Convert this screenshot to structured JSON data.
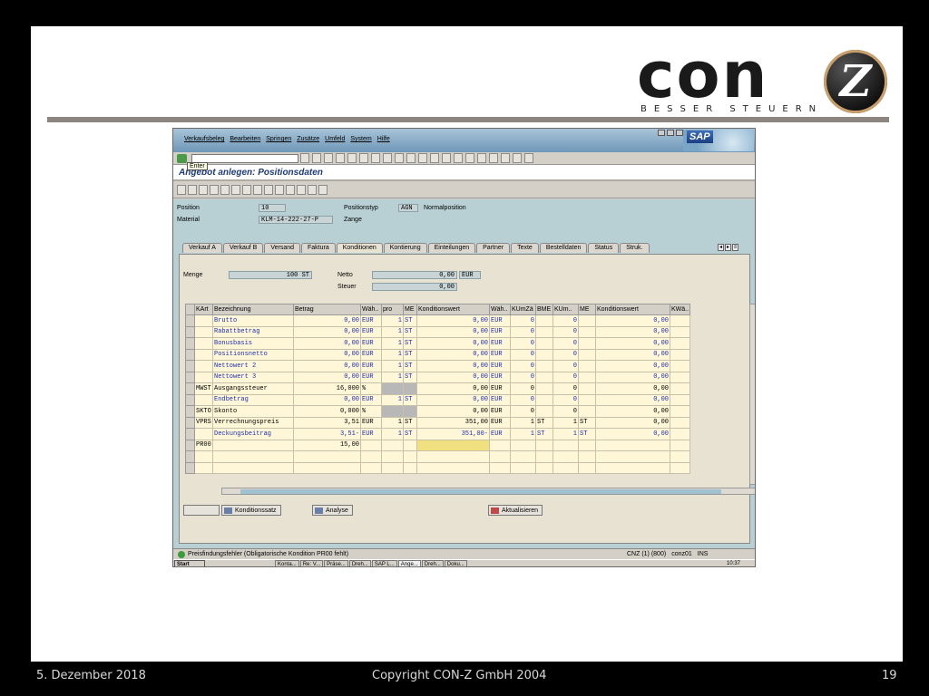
{
  "footer": {
    "date": "5. Dezember 2018",
    "copyright": "Copyright CON-Z GmbH 2004",
    "page": "19"
  },
  "logo": {
    "word": "con",
    "letter": "Z",
    "tagline": "BESSER STEUERN"
  },
  "sap": {
    "menu": [
      "Verkaufsbeleg",
      "Bearbeiten",
      "Springen",
      "Zusätze",
      "Umfeld",
      "System",
      "Hilfe"
    ],
    "logo": "SAP",
    "tooltip": "Enter",
    "title": "Angebot anlegen: Positionsdaten",
    "header": {
      "position_label": "Position",
      "position_value": "10",
      "material_label": "Material",
      "material_value": "KLM-14-222-27-P",
      "postyp_label": "Positionstyp",
      "postyp_value": "AGN",
      "postyp_text": "Normalposition",
      "material_text": "Zange"
    },
    "tabs": [
      "Verkauf A",
      "Verkauf B",
      "Versand",
      "Faktura",
      "Konditionen",
      "Kontierung",
      "Einteilungen",
      "Partner",
      "Texte",
      "Bestelldaten",
      "Status",
      "Struk."
    ],
    "active_tab": "Konditionen",
    "menge_label": "Menge",
    "menge_value": "100 ST",
    "netto_label": "Netto",
    "netto_value": "0,00",
    "netto_cur": "EUR",
    "steuer_label": "Steuer",
    "steuer_value": "0,00",
    "columns": [
      "KArt",
      "Bezeichnung",
      "Betrag",
      "Wäh..",
      "pro",
      "ME",
      "Konditionswert",
      "Wäh..",
      "KUmZä",
      "BME",
      "KUm..",
      "ME",
      "Konditionswert",
      "KWä.."
    ],
    "rows": [
      {
        "kart": "",
        "bez": "Brutto",
        "betrag": "0,00",
        "waeh": "EUR",
        "pro": "1",
        "me": "ST",
        "kwert": "0,00",
        "waeh2": "EUR",
        "kumza": "0",
        "bme": "",
        "kum": "0",
        "me2": "",
        "kwert2": "0,00",
        "blue": true
      },
      {
        "kart": "",
        "bez": "Rabattbetrag",
        "betrag": "0,00",
        "waeh": "EUR",
        "pro": "1",
        "me": "ST",
        "kwert": "0,00",
        "waeh2": "EUR",
        "kumza": "0",
        "bme": "",
        "kum": "0",
        "me2": "",
        "kwert2": "0,00",
        "blue": true
      },
      {
        "kart": "",
        "bez": "Bonusbasis",
        "betrag": "0,00",
        "waeh": "EUR",
        "pro": "1",
        "me": "ST",
        "kwert": "0,00",
        "waeh2": "EUR",
        "kumza": "0",
        "bme": "",
        "kum": "0",
        "me2": "",
        "kwert2": "0,00",
        "blue": true
      },
      {
        "kart": "",
        "bez": "Positionsnetto",
        "betrag": "0,00",
        "waeh": "EUR",
        "pro": "1",
        "me": "ST",
        "kwert": "0,00",
        "waeh2": "EUR",
        "kumza": "0",
        "bme": "",
        "kum": "0",
        "me2": "",
        "kwert2": "0,00",
        "blue": true
      },
      {
        "kart": "",
        "bez": "Nettowert 2",
        "betrag": "0,00",
        "waeh": "EUR",
        "pro": "1",
        "me": "ST",
        "kwert": "0,00",
        "waeh2": "EUR",
        "kumza": "0",
        "bme": "",
        "kum": "0",
        "me2": "",
        "kwert2": "0,00",
        "blue": true
      },
      {
        "kart": "",
        "bez": "Nettowert 3",
        "betrag": "0,00",
        "waeh": "EUR",
        "pro": "1",
        "me": "ST",
        "kwert": "0,00",
        "waeh2": "EUR",
        "kumza": "0",
        "bme": "",
        "kum": "0",
        "me2": "",
        "kwert2": "0,00",
        "blue": true
      },
      {
        "kart": "MWST",
        "bez": "Ausgangssteuer",
        "betrag": "16,000",
        "waeh": "%",
        "pro": "",
        "me": "",
        "kwert": "0,00",
        "waeh2": "EUR",
        "kumza": "0",
        "bme": "",
        "kum": "0",
        "me2": "",
        "kwert2": "0,00",
        "blue": false,
        "grey": true
      },
      {
        "kart": "",
        "bez": "Endbetrag",
        "betrag": "0,00",
        "waeh": "EUR",
        "pro": "1",
        "me": "ST",
        "kwert": "0,00",
        "waeh2": "EUR",
        "kumza": "0",
        "bme": "",
        "kum": "0",
        "me2": "",
        "kwert2": "0,00",
        "blue": true
      },
      {
        "kart": "SKTO",
        "bez": "Skonto",
        "betrag": "0,000",
        "waeh": "%",
        "pro": "",
        "me": "",
        "kwert": "0,00",
        "waeh2": "EUR",
        "kumza": "0",
        "bme": "",
        "kum": "0",
        "me2": "",
        "kwert2": "0,00",
        "blue": false,
        "grey": true
      },
      {
        "kart": "VPRS",
        "bez": "Verrechnungspreis",
        "betrag": "3,51",
        "waeh": "EUR",
        "pro": "1",
        "me": "ST",
        "kwert": "351,00",
        "waeh2": "EUR",
        "kumza": "1",
        "bme": "ST",
        "kum": "1",
        "me2": "ST",
        "kwert2": "0,00",
        "blue": false
      },
      {
        "kart": "",
        "bez": "Deckungsbeitrag",
        "betrag": "3,51-",
        "waeh": "EUR",
        "pro": "1",
        "me": "ST",
        "kwert": "351,00-",
        "waeh2": "EUR",
        "kumza": "1",
        "bme": "ST",
        "kum": "1",
        "me2": "ST",
        "kwert2": "0,00",
        "blue": true
      },
      {
        "kart": "PR00",
        "bez": "",
        "betrag": "15,00",
        "waeh": "",
        "pro": "",
        "me": "",
        "kwert": "",
        "waeh2": "",
        "kumza": "",
        "bme": "",
        "kum": "",
        "me2": "",
        "kwert2": "",
        "blue": false,
        "yellow": true
      }
    ],
    "empty_rows": 2,
    "buttons": {
      "konditionssatz": "Konditionssatz",
      "analyse": "Analyse",
      "aktualisieren": "Aktualisieren"
    },
    "status": {
      "message": "Preisfindungsfehler (Obligatorische Kondition PR00 fehlt)",
      "system": "CNZ (1) (800)",
      "server": "conz01",
      "mode": "INS"
    },
    "taskbar": {
      "start": "Start",
      "tasks": [
        "Konta...",
        "Re: V...",
        "Präse...",
        "Dreh...",
        "SAP L...",
        "Ange...",
        "Dreh...",
        "Doku..."
      ],
      "active": "Ange...",
      "clock": "10:37"
    }
  }
}
